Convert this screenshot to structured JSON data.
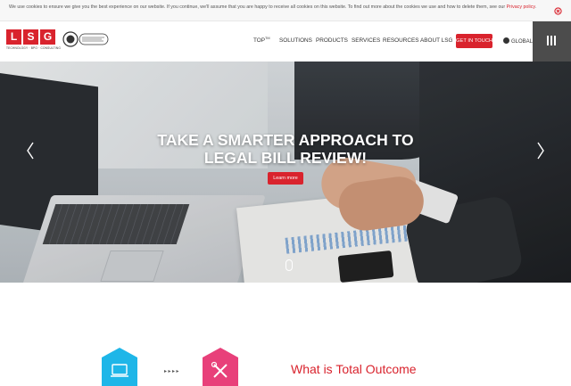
{
  "cookie_bar": {
    "text": "We use cookies to ensure we give you the best experience on our website. If you continue, we'll assume that you are happy to receive all cookies on this website. To find out more about the cookies we use and how to delete them, see our ",
    "link_text": "Privacy policy",
    "after_link": "."
  },
  "header": {
    "logo_letters": [
      "L",
      "S",
      "G"
    ],
    "logo_tagline": "TECHNOLOGY · BPO · CONSULTING",
    "nav": [
      {
        "label": "TOP",
        "sup": "TM"
      },
      {
        "label": "SOLUTIONS"
      },
      {
        "label": "PRODUCTS"
      },
      {
        "label": "SERVICES"
      },
      {
        "label": "RESOURCES"
      },
      {
        "label": "ABOUT LSG"
      }
    ],
    "cta_label": "GET IN TOUCH",
    "region_label": "GLOBAL"
  },
  "hero": {
    "title_line1": "TAKE A SMARTER APPROACH TO",
    "title_line2": "LEGAL BILL REVIEW!",
    "button_label": "Learn more"
  },
  "section": {
    "title": "What is Total Outcome",
    "connector": "▸▸▸▸"
  },
  "colors": {
    "brand_red": "#d9232d",
    "hex_cyan": "#1eb6e8",
    "hex_pink": "#e8407a",
    "menu_dark": "#4c4c4c"
  }
}
